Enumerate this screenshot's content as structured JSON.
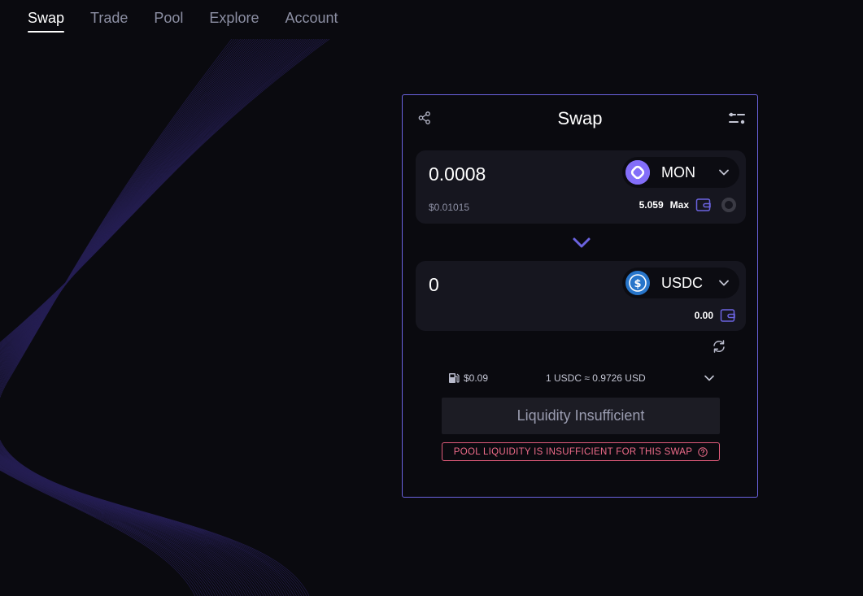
{
  "nav": {
    "items": [
      {
        "label": "Swap",
        "active": true
      },
      {
        "label": "Trade",
        "active": false
      },
      {
        "label": "Pool",
        "active": false
      },
      {
        "label": "Explore",
        "active": false
      },
      {
        "label": "Account",
        "active": false
      }
    ]
  },
  "swap": {
    "title": "Swap",
    "from": {
      "amount": "0.0008",
      "token": "MON",
      "usd_value": "$0.01015",
      "balance": "5.059",
      "max_label": "Max"
    },
    "to": {
      "amount": "0",
      "token": "USDC",
      "balance": "0.00"
    },
    "gas_fee": "$0.09",
    "rate": "1 USDC ≈ 0.9726 USD",
    "action_label": "Liquidity Insufficient",
    "error_message": "POOL LIQUIDITY IS INSUFFICIENT FOR THIS SWAP"
  },
  "colors": {
    "accent": "#6b63e0",
    "error": "#ef6c8a",
    "mon_logo": "#836ef9",
    "usdc_logo": "#2775ca"
  },
  "icons": [
    "share-icon",
    "settings-icon",
    "chevron-down-icon",
    "wallet-icon",
    "arrow-down-icon",
    "refresh-icon",
    "gas-pump-icon",
    "help-icon"
  ]
}
